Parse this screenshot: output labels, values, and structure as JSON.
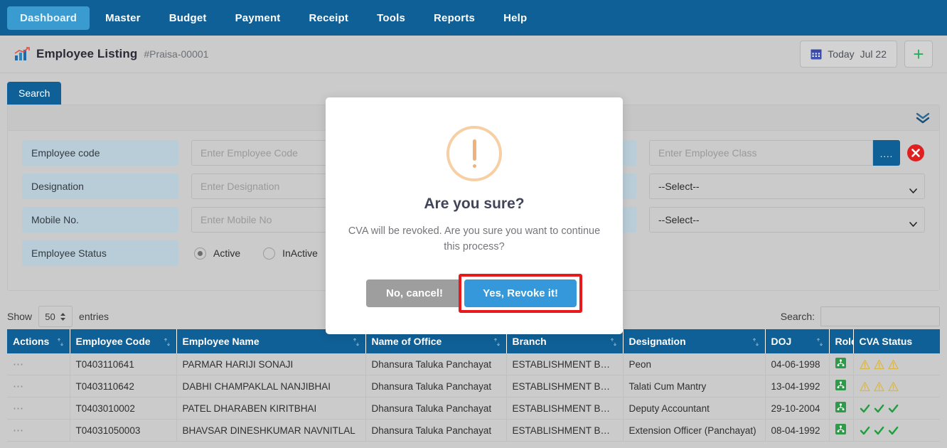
{
  "nav": {
    "items": [
      {
        "label": "Dashboard",
        "active": true
      },
      {
        "label": "Master",
        "active": false
      },
      {
        "label": "Budget",
        "active": false
      },
      {
        "label": "Payment",
        "active": false
      },
      {
        "label": "Receipt",
        "active": false
      },
      {
        "label": "Tools",
        "active": false
      },
      {
        "label": "Reports",
        "active": false
      },
      {
        "label": "Help",
        "active": false
      }
    ]
  },
  "header": {
    "title": "Employee Listing",
    "ref": "#Praisa-00001",
    "today_label": "Today",
    "today_date": "Jul 22",
    "add_label": "+",
    "icons": {
      "chart": "chart-icon",
      "calendar": "calendar-icon",
      "add": "plus-icon"
    }
  },
  "search_panel": {
    "tab_label": "Search",
    "fields": {
      "employee_code_label": "Employee code",
      "employee_code_placeholder": "Enter Employee Code",
      "designation_label": "Designation",
      "designation_placeholder": "Enter Designation",
      "mobile_label": "Mobile No.",
      "mobile_placeholder": "Enter Mobile No",
      "status_label": "Employee Status",
      "status_active": "Active",
      "status_inactive": "InActive",
      "employee_class_placeholder": "Enter Employee Class",
      "lookup_button": "....",
      "select_one": "--Select--",
      "select_two": "--Select--"
    }
  },
  "table_tools": {
    "show_label": "Show",
    "show_value": "50",
    "entries_label": "entries",
    "search_label": "Search:",
    "search_value": ""
  },
  "table": {
    "columns": [
      {
        "label": "Actions",
        "sortable": true
      },
      {
        "label": "Employee Code",
        "sortable": true
      },
      {
        "label": "Employee Name",
        "sortable": true
      },
      {
        "label": "Name of Office",
        "sortable": true
      },
      {
        "label": "Branch",
        "sortable": true
      },
      {
        "label": "Designation",
        "sortable": true
      },
      {
        "label": "DOJ",
        "sortable": true
      },
      {
        "label": "Role",
        "sortable": false
      },
      {
        "label": "CVA Status",
        "sortable": false
      }
    ],
    "rows": [
      {
        "actions": "⋯",
        "code": "T0403110641",
        "name": "PARMAR HARIJI SONAJI",
        "office": "Dhansura Taluka Panchayat",
        "branch": "ESTABLISHMENT BRANCH",
        "designation": "Peon",
        "doj": "04-06-1998",
        "role": "role-badge-icon",
        "cva": [
          "warning-icon",
          "warning-icon",
          "warning-icon"
        ]
      },
      {
        "actions": "⋯",
        "code": "T0403110642",
        "name": "DABHI CHAMPAKLAL NANJIBHAI",
        "office": "Dhansura Taluka Panchayat",
        "branch": "ESTABLISHMENT BRANCH",
        "designation": "Talati Cum Mantry",
        "doj": "13-04-1992",
        "role": "role-badge-icon",
        "cva": [
          "warning-icon",
          "warning-icon",
          "warning-icon"
        ]
      },
      {
        "actions": "⋯",
        "code": "T0403010002",
        "name": "PATEL DHARABEN KIRITBHAI",
        "office": "Dhansura Taluka Panchayat",
        "branch": "ESTABLISHMENT BRANCH",
        "designation": "Deputy Accountant",
        "doj": "29-10-2004",
        "role": "role-badge-icon",
        "cva": [
          "check-icon",
          "check-icon",
          "check-icon"
        ]
      },
      {
        "actions": "⋯",
        "code": "T04031050003",
        "name": "BHAVSAR DINESHKUMAR NAVNITLAL",
        "office": "Dhansura Taluka Panchayat",
        "branch": "ESTABLISHMENT BRANCH",
        "designation": "Extension Officer (Panchayat)",
        "doj": "08-04-1992",
        "role": "role-badge-icon",
        "cva": [
          "check-icon",
          "check-icon",
          "check-icon"
        ]
      }
    ]
  },
  "modal": {
    "title": "Are you sure?",
    "text": "CVA will be revoked. Are you sure you want to continue this process?",
    "cancel_label": "No, cancel!",
    "confirm_label": "Yes, Revoke it!",
    "icon": "warning-exclamation-icon"
  },
  "colors": {
    "nav_blue": "#0f6097",
    "nav_active": "#3a9bd0",
    "page_bg": "#cbcbcb",
    "label_blue": "#b9cdd8",
    "confirm_blue": "#3498db",
    "cancel_gray": "#9e9e9e",
    "highlight_red": "#e8191d",
    "warn_orange": "#f0b27a",
    "role_green": "#2e9a4a",
    "check_green": "#1e9e3e",
    "warn_yellow": "#d9b646"
  }
}
